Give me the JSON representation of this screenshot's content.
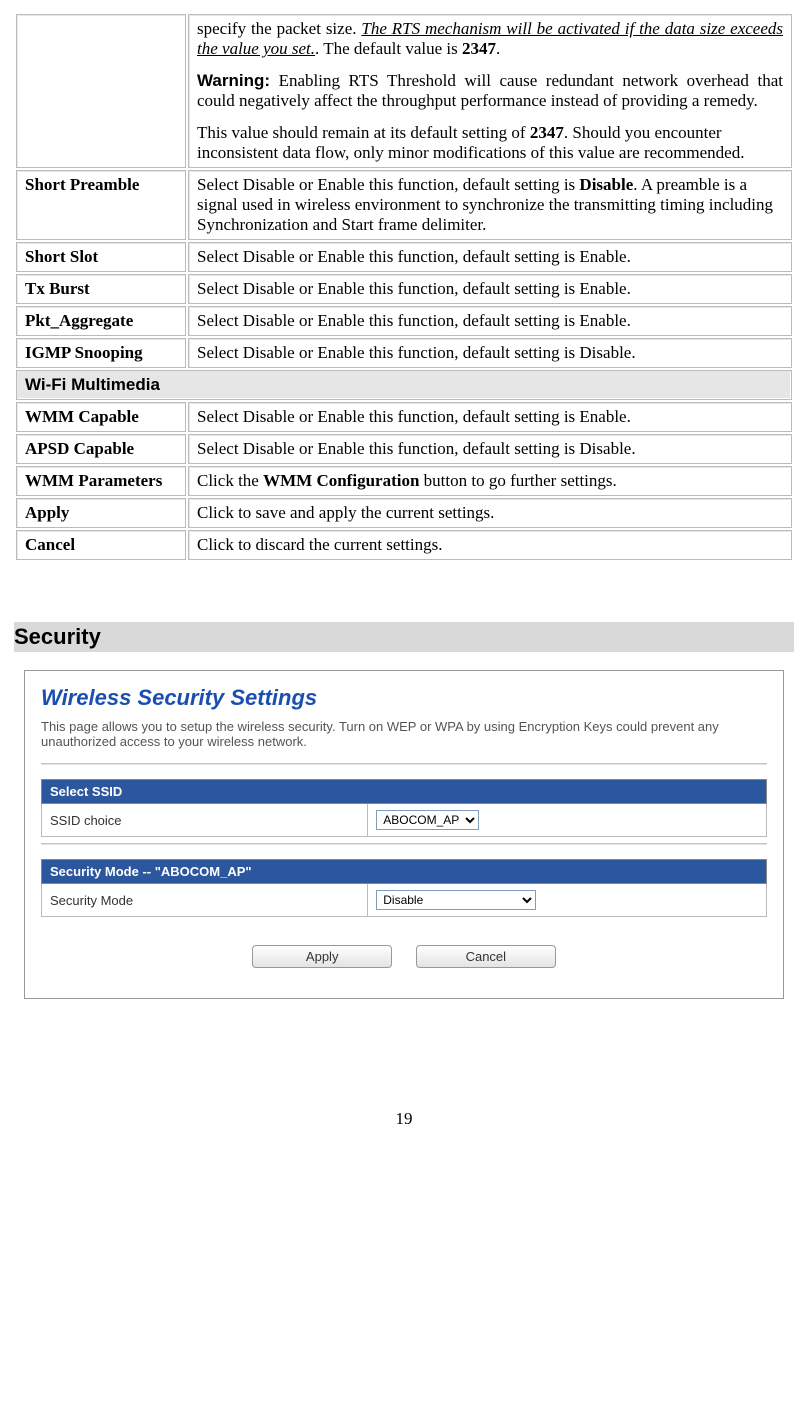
{
  "spec_table": {
    "row0": {
      "p1_prefix": "specify the packet size. ",
      "p1_underline": "The RTS mechanism will be activated if the data size exceeds the value you set.",
      "p1_mid": ". The default value is ",
      "p1_bold": "2347",
      "p1_suffix": ".",
      "warn_label": "Warning:",
      "warn_text": " Enabling RTS Threshold will cause redundant network overhead that could negatively affect the throughput performance instead of providing a remedy.",
      "p3_prefix": "This value should remain at its default setting of ",
      "p3_bold": "2347",
      "p3_suffix": ".  Should you encounter inconsistent data flow, only minor modifications of this value are recommended."
    },
    "short_preamble": {
      "label": "Short Preamble",
      "d_prefix": "Select Disable or Enable this function, default setting is ",
      "d_bold": "Disable",
      "d_suffix": ". A preamble is a signal used in wireless environment to synchronize the transmitting timing including Synchronization and Start frame delimiter."
    },
    "short_slot": {
      "label": "Short Slot",
      "desc": "Select Disable or Enable this function, default setting is Enable."
    },
    "tx_burst": {
      "label": "Tx Burst",
      "desc": "Select Disable or Enable this function, default setting is Enable."
    },
    "pkt_aggr": {
      "label": "Pkt_Aggregate",
      "desc": "Select Disable or Enable this function, default setting is Enable."
    },
    "igmp": {
      "label": "IGMP Snooping",
      "desc": "Select Disable or Enable this function, default setting is Disable."
    },
    "section_wfm": "Wi-Fi Multimedia",
    "wmm_cap": {
      "label": "WMM Capable",
      "desc": "Select Disable or Enable this function, default setting is Enable."
    },
    "apsd": {
      "label": "APSD Capable",
      "desc": "Select Disable or Enable this function, default setting is Disable."
    },
    "wmm_param": {
      "label": "WMM Parameters",
      "d_prefix": "Click the ",
      "d_bold": "WMM Configuration",
      "d_suffix": " button to go further settings."
    },
    "apply": {
      "label": "Apply",
      "desc": "Click to save and apply the current settings."
    },
    "cancel": {
      "label": "Cancel",
      "desc": "Click to discard the current settings."
    }
  },
  "security": {
    "heading": "Security",
    "panel_title": "Wireless Security Settings",
    "panel_desc": "This page allows you to setup the wireless security. Turn on WEP or WPA by using Encryption Keys could prevent any unauthorized access to your wireless network.",
    "select_ssid_bar": "Select SSID",
    "ssid_choice_label": "SSID choice",
    "ssid_value": "ABOCOM_AP",
    "mode_bar": "Security Mode -- \"ABOCOM_AP\"",
    "mode_label": "Security Mode",
    "mode_value": "Disable",
    "apply_btn": "Apply",
    "cancel_btn": "Cancel"
  },
  "page_number": "19"
}
